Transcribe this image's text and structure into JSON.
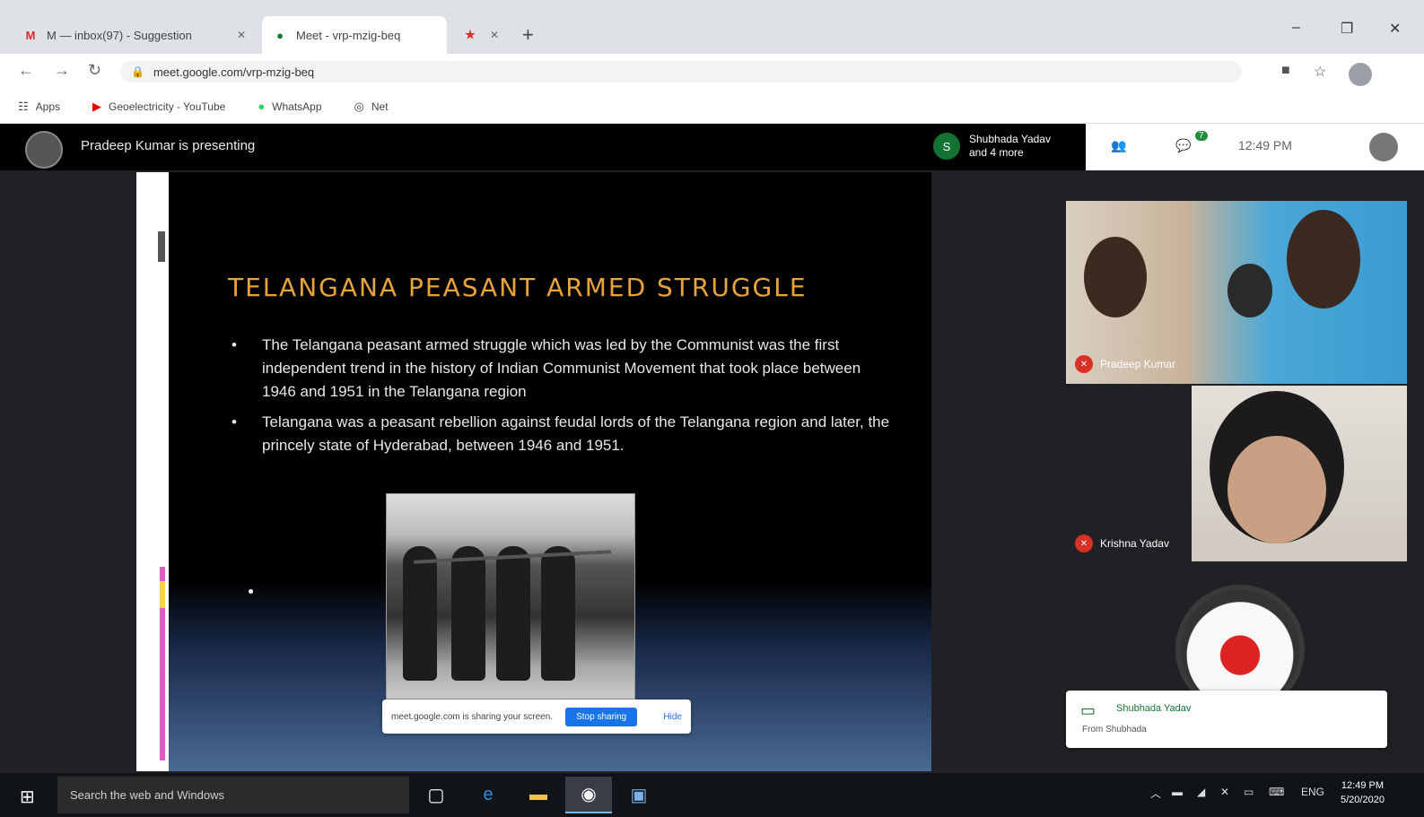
{
  "browser": {
    "tabs": [
      {
        "label": "M  — inbox(97) - Suggestion",
        "icon": "gmail-icon",
        "active": false
      },
      {
        "label": "Meet - vrp-mzig-beq",
        "icon": "meet-icon",
        "active": true
      },
      {
        "label": "",
        "icon": "star-icon",
        "active": false
      }
    ],
    "new_tab": "+",
    "url": "meet.google.com/vrp-mzig-beq",
    "bookmarks": [
      {
        "label": "Apps",
        "icon": "apps-icon"
      },
      {
        "label": "Geoelectricity - YouTube",
        "icon": "youtube-icon"
      },
      {
        "label": "WhatsApp",
        "icon": "whatsapp-icon"
      },
      {
        "label": "Net",
        "icon": "globe-icon"
      }
    ]
  },
  "meet": {
    "presenter_text": "Pradeep Kumar is presenting",
    "pinned_user_initial": "S",
    "pinned_user_line1": "Shubhada Yadav",
    "pinned_user_line2": "and 4 more",
    "participant_count": "7",
    "time": "12:49 PM",
    "slide": {
      "title": "TELANGANA PEASANT ARMED STRUGGLE",
      "bullets": [
        "The Telangana peasant armed struggle which was led by the Communist was the first independent trend in the history of Indian Communist Movement that took place between 1946 and 1951 in the Telangana region",
        "Telangana was a peasant rebellion against feudal lords of the Telangana region and later, the princely state of Hyderabad, between 1946 and 1951."
      ]
    },
    "share_bar": {
      "text": "meet.google.com is sharing your screen.",
      "stop_label": "Stop sharing",
      "hide_label": "Hide"
    },
    "participants": [
      {
        "name": "Pradeep Kumar"
      },
      {
        "name": "Krishna Yadav"
      }
    ],
    "notification": {
      "name": "Shubhada Yadav",
      "sub": "From Shubhada"
    }
  },
  "taskbar": {
    "search_placeholder": "Search the web and Windows",
    "tray_lang": "ENG",
    "clock_time": "12:49 PM",
    "clock_date": "5/20/2020"
  }
}
